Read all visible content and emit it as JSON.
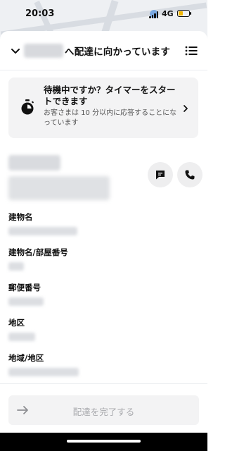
{
  "status_bar": {
    "time": "20:03",
    "network": "4G",
    "battery_level": 0.35
  },
  "header": {
    "title_suffix": "へ配達に向かっています"
  },
  "timer_card": {
    "title": "待機中ですか？タイマーをスタートできます",
    "description": "お客さまは 10 分以内に応答することになっています"
  },
  "fields": [
    {
      "label": "建物名"
    },
    {
      "label": "建物名/部屋番号"
    },
    {
      "label": "郵便番号"
    },
    {
      "label": "地区"
    },
    {
      "label": "地域/地区"
    }
  ],
  "footer": {
    "complete_label": "配達を完了する"
  },
  "icons": {
    "back": "chevron-down-icon",
    "menu": "list-icon",
    "timer": "stopwatch-icon",
    "message": "chat-icon",
    "phone": "phone-icon",
    "arrow": "arrow-right-icon"
  },
  "colors": {
    "battery": "#f2b705",
    "disabled_text": "#a8a9ad"
  }
}
